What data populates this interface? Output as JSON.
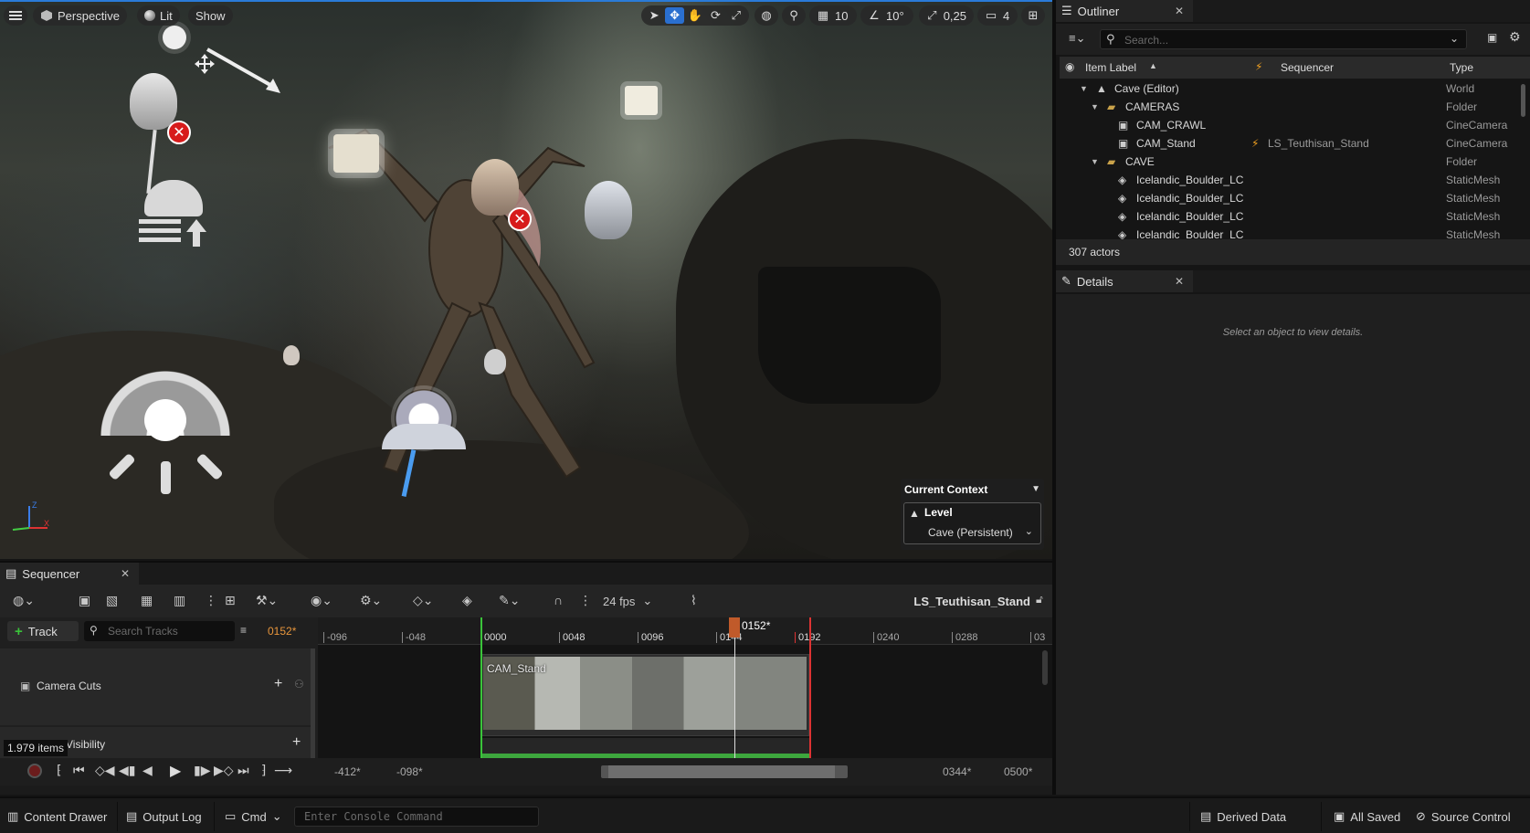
{
  "viewport": {
    "perspective_label": "Perspective",
    "lit_label": "Lit",
    "show_label": "Show",
    "grid_value": "10",
    "angle_value": "10°",
    "scale_value": "0,25",
    "camera_speed": "4",
    "context": {
      "title": "Current Context",
      "level_label": "Level",
      "level_value": "Cave (Persistent)"
    }
  },
  "outliner": {
    "tab_label": "Outliner",
    "search_placeholder": "Search...",
    "columns": {
      "label": "Item Label",
      "sequencer": "Sequencer",
      "type": "Type"
    },
    "rows": [
      {
        "label": "Cave (Editor)",
        "sequencer": "",
        "type": "World",
        "icon": "world-icon"
      },
      {
        "label": "CAMERAS",
        "sequencer": "",
        "type": "Folder",
        "icon": "folder-icon"
      },
      {
        "label": "CAM_CRAWL",
        "sequencer": "",
        "type": "CineCamera",
        "icon": "camera-icon"
      },
      {
        "label": "CAM_Stand",
        "sequencer": "LS_Teuthisan_Stand",
        "type": "CineCamera",
        "icon": "camera-icon"
      },
      {
        "label": "CAVE",
        "sequencer": "",
        "type": "Folder",
        "icon": "folder-icon"
      },
      {
        "label": "Icelandic_Boulder_LC",
        "sequencer": "",
        "type": "StaticMesh",
        "icon": "mesh-icon"
      },
      {
        "label": "Icelandic_Boulder_LC",
        "sequencer": "",
        "type": "StaticMesh",
        "icon": "mesh-icon"
      },
      {
        "label": "Icelandic_Boulder_LC",
        "sequencer": "",
        "type": "StaticMesh",
        "icon": "mesh-icon"
      },
      {
        "label": "Icelandic_Boulder_LC",
        "sequencer": "",
        "type": "StaticMesh",
        "icon": "mesh-icon"
      }
    ],
    "count": "307 actors"
  },
  "details": {
    "tab_label": "Details",
    "empty_message": "Select an object to view details."
  },
  "sequencer": {
    "tab_label": "Sequencer",
    "fps": "24 fps",
    "sequence_name": "LS_Teuthisan_Stand",
    "add_track_label": "Track",
    "search_placeholder": "Search Tracks",
    "current_frame": "0152*",
    "playhead_label": "0152*",
    "ruler_ticks": [
      "-096",
      "-048",
      "0000",
      "0048",
      "0096",
      "0144",
      "0192",
      "0240",
      "0288",
      "03"
    ],
    "tracks": [
      {
        "label": "Camera Cuts"
      },
      {
        "label": "Level Visibility"
      }
    ],
    "clip_label": "CAM_Stand",
    "items_tooltip": "1.979 items",
    "range_start": "-412*",
    "view_start": "-098*",
    "view_end": "0344*",
    "range_end": "0500*"
  },
  "bottombar": {
    "content_drawer": "Content Drawer",
    "output_log": "Output Log",
    "cmd": "Cmd",
    "console_placeholder": "Enter Console Command",
    "derived_data": "Derived Data",
    "all_saved": "All Saved",
    "source_control": "Source Control"
  }
}
